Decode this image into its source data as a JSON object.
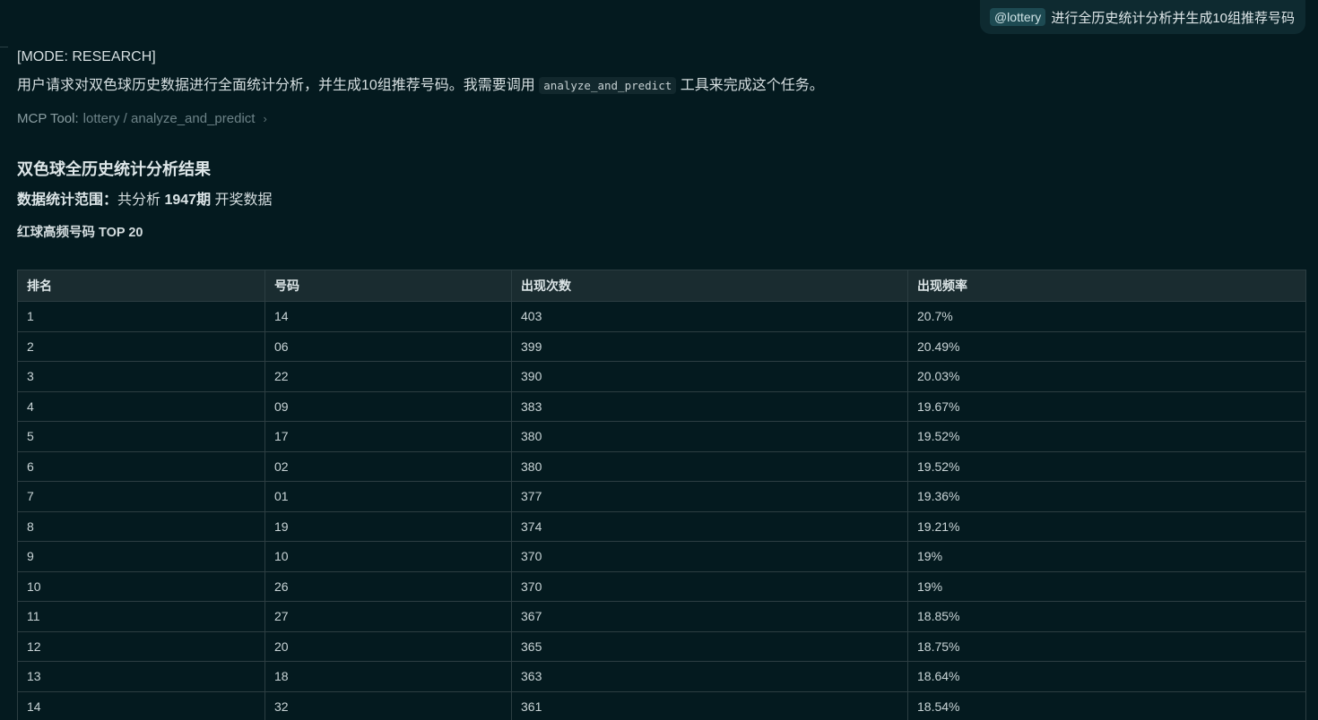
{
  "user_message": {
    "mention": "@lottery",
    "text": "进行全历史统计分析并生成10组推荐号码"
  },
  "assistant": {
    "mode": "[MODE: RESEARCH]",
    "intro_before": "用户请求对双色球历史数据进行全面统计分析，并生成10组推荐号码。我需要调用",
    "intro_code": "analyze_and_predict",
    "intro_after": "工具来完成这个任务。",
    "mcp_label": "MCP Tool:",
    "mcp_path": "lottery / analyze_and_predict",
    "result_title": "双色球全历史统计分析结果",
    "scope_label": "数据统计范围：",
    "scope_pre": "共分析",
    "scope_count": "1947期",
    "scope_post": "开奖数据",
    "table_heading": "红球高频号码 TOP 20"
  },
  "table": {
    "headers": [
      "排名",
      "号码",
      "出现次数",
      "出现频率"
    ],
    "rows": [
      [
        "1",
        "14",
        "403",
        "20.7%"
      ],
      [
        "2",
        "06",
        "399",
        "20.49%"
      ],
      [
        "3",
        "22",
        "390",
        "20.03%"
      ],
      [
        "4",
        "09",
        "383",
        "19.67%"
      ],
      [
        "5",
        "17",
        "380",
        "19.52%"
      ],
      [
        "6",
        "02",
        "380",
        "19.52%"
      ],
      [
        "7",
        "01",
        "377",
        "19.36%"
      ],
      [
        "8",
        "19",
        "374",
        "19.21%"
      ],
      [
        "9",
        "10",
        "370",
        "19%"
      ],
      [
        "10",
        "26",
        "370",
        "19%"
      ],
      [
        "11",
        "27",
        "367",
        "18.85%"
      ],
      [
        "12",
        "20",
        "365",
        "18.75%"
      ],
      [
        "13",
        "18",
        "363",
        "18.64%"
      ],
      [
        "14",
        "32",
        "361",
        "18.54%"
      ]
    ]
  }
}
